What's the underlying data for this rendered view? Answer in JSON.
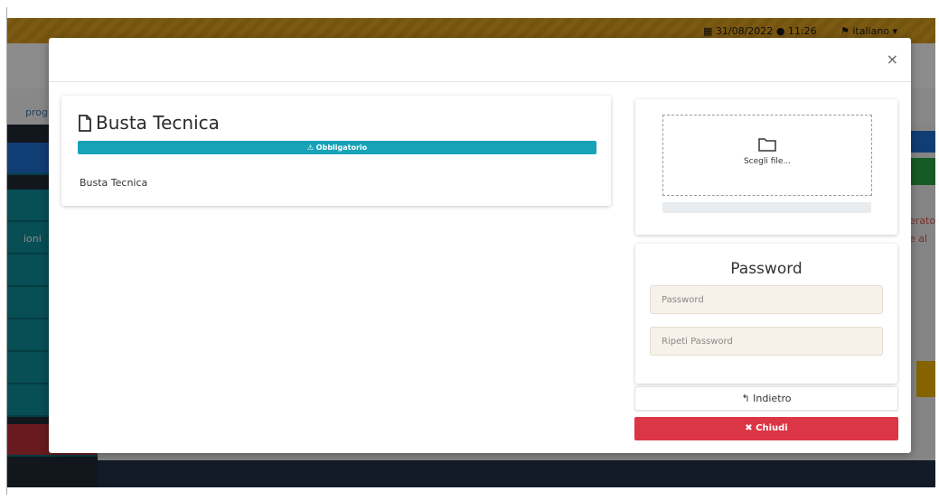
{
  "topbar": {
    "date": "31/08/2022",
    "time": "11:26",
    "language": "italiano"
  },
  "background": {
    "breadcrumb_fragment": "prog",
    "sidebar_fragment": "ioni",
    "right_fragment_1": "erato",
    "right_fragment_2": "e al"
  },
  "modal": {
    "close_symbol": "×",
    "document": {
      "title": "Busta Tecnica",
      "required_badge": "Obbligatorio",
      "description": "Busta Tecnica"
    },
    "upload": {
      "choose_file_label": "Scegli file...",
      "progress": 0
    },
    "password": {
      "title": "Password",
      "password_placeholder": "Password",
      "repeat_placeholder": "Ripeti Password"
    },
    "buttons": {
      "back_label": "Indietro",
      "close_label": "Chiudi"
    }
  },
  "colors": {
    "topbar": "#e3a522",
    "required_bar": "#17a2b8",
    "close_button": "#dc3545",
    "input_bg": "#f8f1e9"
  }
}
